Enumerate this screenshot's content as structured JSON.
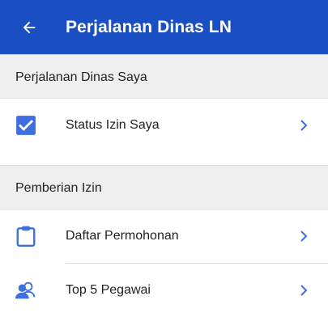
{
  "colors": {
    "primary": "#1a4fc4",
    "accent": "#3d6fe0",
    "section_bg": "#efefef"
  },
  "header": {
    "back_icon": "arrow-left-icon",
    "title": "Perjalanan Dinas LN"
  },
  "sections": [
    {
      "title": "Perjalanan Dinas Saya",
      "items": [
        {
          "label": "Status Izin Saya",
          "icon": "checkbox-icon"
        }
      ]
    },
    {
      "title": "Pemberian Izin",
      "items": [
        {
          "label": "Daftar Permohonan",
          "icon": "clipboard-icon"
        },
        {
          "label": "Top 5 Pegawai",
          "icon": "people-icon"
        }
      ]
    }
  ]
}
